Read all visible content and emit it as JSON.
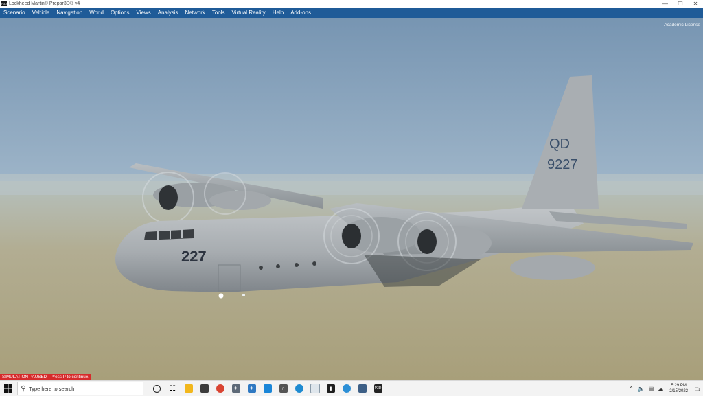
{
  "window": {
    "title": "Lockheed Martin® Prepar3D® v4",
    "icon_name": "prepar3d-app-icon",
    "controls": [
      "minimize-icon",
      "restore-icon",
      "close-icon"
    ]
  },
  "menu": {
    "items": [
      "Scenario",
      "Vehicle",
      "Navigation",
      "World",
      "Options",
      "Views",
      "Analysis",
      "Network",
      "Tools",
      "Virtual Reality",
      "Help",
      "Add-ons"
    ]
  },
  "scene": {
    "license_text": "Academic License",
    "aircraft": {
      "tail_code": "QD",
      "tail_number": "9227",
      "nose_number": "227"
    }
  },
  "status": {
    "paused_text": "SIMULATION PAUSED - Press P to continue."
  },
  "taskbar": {
    "search_placeholder": "Type here to search",
    "apps": [
      {
        "name": "cortana-icon"
      },
      {
        "name": "task-view-icon"
      },
      {
        "name": "file-explorer-icon"
      },
      {
        "name": "store-icon"
      },
      {
        "name": "chrome-icon"
      },
      {
        "name": "flight-app-icon"
      },
      {
        "name": "plane-app-icon"
      },
      {
        "name": "blue-app-icon"
      },
      {
        "name": "bridge-app-icon"
      },
      {
        "name": "edge-icon"
      },
      {
        "name": "notepad-icon"
      },
      {
        "name": "terminal-icon"
      },
      {
        "name": "globe-app-icon"
      },
      {
        "name": "document-app-icon"
      },
      {
        "name": "p3d-icon"
      }
    ],
    "tray": {
      "time": "5:29 PM",
      "date": "2/15/2022",
      "notification_count": "1"
    }
  }
}
